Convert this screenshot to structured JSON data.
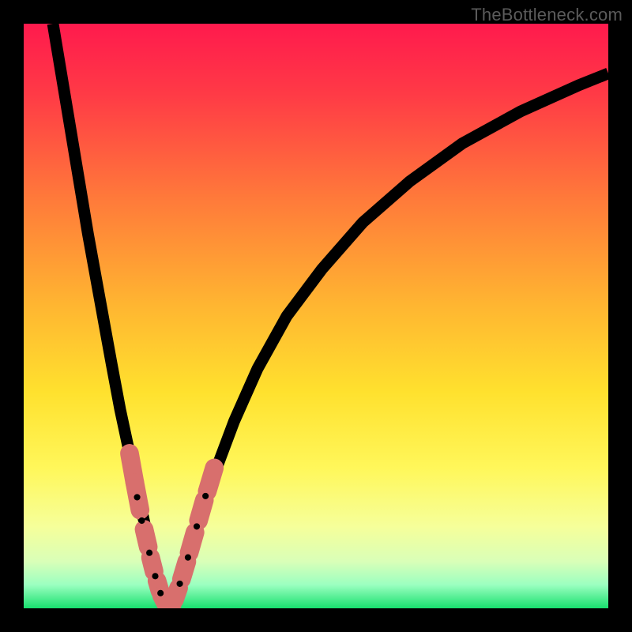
{
  "watermark": "TheBottleneck.com",
  "gradient_stops": [
    {
      "offset": 0.0,
      "color": "#ff1a4d"
    },
    {
      "offset": 0.12,
      "color": "#ff3a46"
    },
    {
      "offset": 0.3,
      "color": "#ff7a3a"
    },
    {
      "offset": 0.48,
      "color": "#ffb531"
    },
    {
      "offset": 0.63,
      "color": "#ffe12e"
    },
    {
      "offset": 0.76,
      "color": "#fff75a"
    },
    {
      "offset": 0.86,
      "color": "#f6ff9a"
    },
    {
      "offset": 0.92,
      "color": "#d9ffb8"
    },
    {
      "offset": 0.96,
      "color": "#9bffc0"
    },
    {
      "offset": 1.0,
      "color": "#18e06e"
    }
  ],
  "chart_data": {
    "type": "line",
    "title": "",
    "xlabel": "",
    "ylabel": "",
    "xlim": [
      0,
      100
    ],
    "ylim": [
      0,
      100
    ],
    "series": [
      {
        "name": "left-branch",
        "x": [
          5,
          7,
          9,
          11,
          13,
          15,
          16.5,
          18,
          19.5,
          21,
          22,
          23,
          23.5,
          24,
          24.5
        ],
        "y": [
          100,
          88,
          76,
          64,
          53,
          42,
          34,
          27,
          20,
          13,
          8.5,
          5,
          3,
          1.5,
          0.5
        ]
      },
      {
        "name": "right-branch",
        "x": [
          25.5,
          26,
          27,
          28,
          29.5,
          31,
          33,
          36,
          40,
          45,
          51,
          58,
          66,
          75,
          85,
          95,
          100
        ],
        "y": [
          0.5,
          2,
          5,
          8.5,
          13,
          18,
          24,
          32,
          41,
          50,
          58,
          66,
          73,
          79.5,
          85,
          89.5,
          91.5
        ]
      }
    ],
    "valley_floor": {
      "x": [
        24.5,
        25.5
      ],
      "y": [
        0.5,
        0.5
      ]
    },
    "marker_clusters": [
      {
        "branch": "left-branch",
        "segments": [
          {
            "x0": 18.1,
            "y0": 26.5,
            "x1": 19.0,
            "y1": 21.5,
            "w": 3.2
          },
          {
            "x0": 19.0,
            "y0": 21.5,
            "x1": 19.9,
            "y1": 16.8,
            "w": 3.2
          },
          {
            "x0": 20.6,
            "y0": 13.5,
            "x1": 21.3,
            "y1": 10.5,
            "w": 3.2
          },
          {
            "x0": 21.7,
            "y0": 8.7,
            "x1": 22.3,
            "y1": 6.3,
            "w": 3.2
          },
          {
            "x0": 22.8,
            "y0": 4.7,
            "x1": 23.3,
            "y1": 3.0,
            "w": 3.2
          },
          {
            "x0": 23.6,
            "y0": 2.2,
            "x1": 24.2,
            "y1": 1.0,
            "w": 3.2
          }
        ],
        "dots": [
          {
            "x": 19.4,
            "y": 19.0
          },
          {
            "x": 20.2,
            "y": 15.0
          },
          {
            "x": 21.5,
            "y": 9.5
          },
          {
            "x": 22.5,
            "y": 5.5
          },
          {
            "x": 23.4,
            "y": 2.6
          }
        ]
      },
      {
        "branch": "right-branch",
        "segments": [
          {
            "x0": 24.6,
            "y0": 0.7,
            "x1": 25.4,
            "y1": 0.7,
            "w": 3.2
          },
          {
            "x0": 25.8,
            "y0": 1.5,
            "x1": 26.5,
            "y1": 3.5,
            "w": 3.2
          },
          {
            "x0": 27.0,
            "y0": 5.0,
            "x1": 27.9,
            "y1": 8.0,
            "w": 3.2
          },
          {
            "x0": 28.3,
            "y0": 9.5,
            "x1": 29.3,
            "y1": 13.0,
            "w": 3.2
          },
          {
            "x0": 29.9,
            "y0": 15.0,
            "x1": 30.9,
            "y1": 18.5,
            "w": 3.2
          },
          {
            "x0": 31.4,
            "y0": 20.0,
            "x1": 32.6,
            "y1": 24.0,
            "w": 3.2
          }
        ],
        "dots": [
          {
            "x": 26.7,
            "y": 4.2
          },
          {
            "x": 28.1,
            "y": 8.7
          },
          {
            "x": 29.6,
            "y": 14.0
          },
          {
            "x": 31.1,
            "y": 19.2
          }
        ]
      }
    ],
    "marker_color": "#d86f6d"
  }
}
